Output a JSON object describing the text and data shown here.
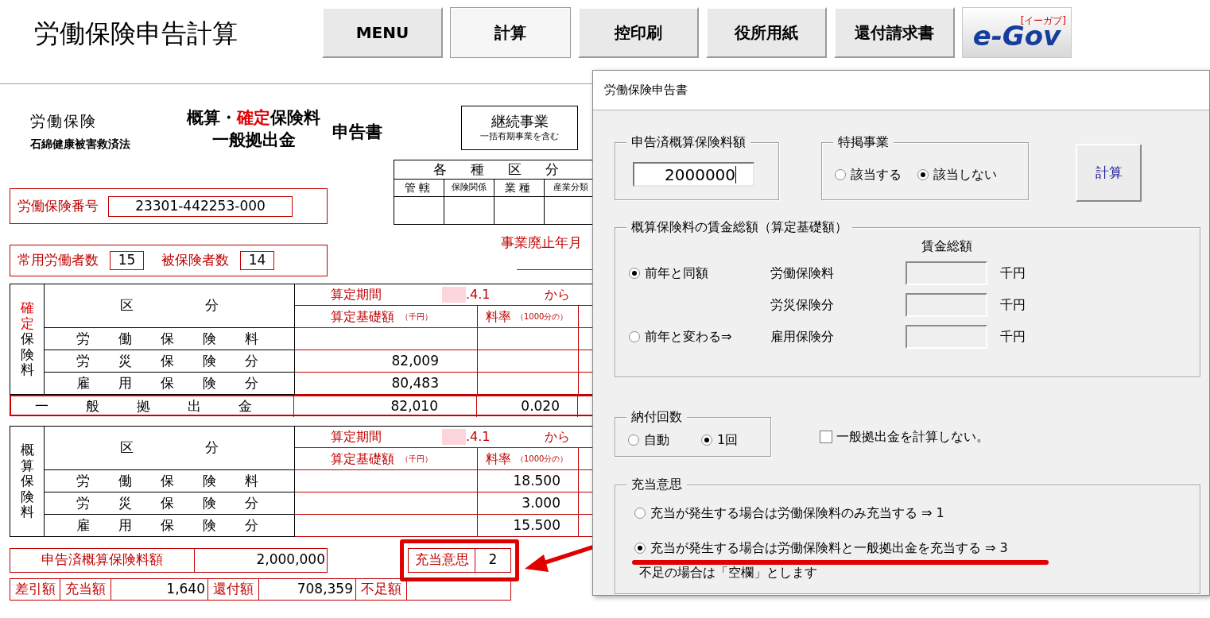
{
  "app_title": "労働保険申告計算",
  "toolbar": [
    {
      "label": "MENU",
      "selected": false
    },
    {
      "label": "計算",
      "selected": true
    },
    {
      "label": "控印刷",
      "selected": false
    },
    {
      "label": "役所用紙",
      "selected": false
    },
    {
      "label": "還付請求書",
      "selected": false
    }
  ],
  "logo": {
    "text": "e-Gov",
    "reading": "[イーガブ]"
  },
  "form": {
    "law_name": "労働保険",
    "law_sub": "石綿健康被害救済法",
    "title_parts": [
      {
        "text": "概算・",
        "highlight": false
      },
      {
        "text": "確定",
        "highlight": true
      },
      {
        "text": "保険料",
        "highlight": false
      }
    ],
    "title_line2": "一般拠出金",
    "title_suffix": "申告書",
    "business_type": {
      "title": "継続事業",
      "note": "一括有期事業を含む"
    },
    "category_table": {
      "title": "各種区分",
      "columns": [
        "管轄",
        "保険関係",
        "業種",
        "産業分類"
      ]
    },
    "insurance_number": {
      "label": "労働保険番号",
      "value": "23301-442253-000"
    },
    "workers": [
      {
        "label": "常用労働者数",
        "value": "15"
      },
      {
        "label": "被保険者数",
        "value": "14"
      }
    ],
    "closure_label": "事業廃止年月",
    "confirmed_table": {
      "side_label": [
        {
          "text": "確定",
          "highlight": true
        },
        {
          "text": "保険料",
          "highlight": false
        }
      ],
      "header": "区分",
      "period_label": "算定期間",
      "period_date": ".4.1",
      "period_from": "から",
      "base_header": "算定基礎額",
      "base_unit": "（千円）",
      "rate_header": "料率",
      "rate_unit": "（1000分の）",
      "rows": [
        {
          "label": "労働保険料"
        },
        {
          "label": "労災保険分",
          "base": "82,009"
        },
        {
          "label": "雇用保険分",
          "base": "80,483"
        }
      ]
    },
    "general_contribution": {
      "label": "一般拠出金",
      "base": "82,010",
      "rate": "0.020"
    },
    "estimated_table": {
      "side_label": [
        {
          "text": "概算保険料",
          "highlight": false
        }
      ],
      "header": "区分",
      "period_label": "算定期間",
      "period_date": ".4.1",
      "period_from": "から",
      "base_header": "算定基礎額",
      "base_unit": "（千円）",
      "rate_header": "料率",
      "rate_unit": "（1000分の）",
      "rows": [
        {
          "label": "労働保険料",
          "rate": "18.500"
        },
        {
          "label": "労災保険分",
          "rate": "3.000"
        },
        {
          "label": "雇用保険分",
          "rate": "15.500"
        }
      ]
    },
    "declared": {
      "label": "申告済概算保険料額",
      "value": "2,000,000"
    },
    "allocation": {
      "label": "充当意思",
      "value": "2",
      "highlighted": true
    },
    "balance_title": "差引額",
    "balance_items": [
      {
        "label": "充当額",
        "value": "1,640"
      },
      {
        "label": "還付額",
        "value": "708,359"
      },
      {
        "label": "不足額"
      }
    ]
  },
  "dialog": {
    "title": "労働保険申告書",
    "declared_group": {
      "legend": "申告済概算保険料額",
      "value": "2000000"
    },
    "special_group": {
      "legend": "特掲事業",
      "options": [
        {
          "label": "該当する",
          "selected": false
        },
        {
          "label": "該当しない",
          "selected": true
        }
      ]
    },
    "calc_button": "計算",
    "wage_group": {
      "legend": "概算保険料の賃金総額（算定基礎額）",
      "column_header": "賃金総額",
      "options": [
        {
          "label": "前年と同額",
          "selected": true
        },
        {
          "label": "前年と変わる⇒",
          "selected": false
        }
      ],
      "fields": [
        {
          "label": "労働保険料",
          "unit": "千円",
          "disabled": true
        },
        {
          "label": "労災保険分",
          "unit": "千円",
          "disabled": true
        },
        {
          "label": "雇用保険分",
          "unit": "千円",
          "disabled": true
        }
      ]
    },
    "payment_group": {
      "legend": "納付回数",
      "options": [
        {
          "label": "自動",
          "selected": false
        },
        {
          "label": "1回",
          "selected": true
        }
      ]
    },
    "no_contribution": {
      "label": "一般拠出金を計算しない。",
      "checked": false
    },
    "allocation_group": {
      "legend": "充当意思",
      "options": [
        {
          "label": "充当が発生する場合は労働保険料のみ充当する ⇒ 1",
          "selected": false,
          "annotated": false
        },
        {
          "label": "充当が発生する場合は労働保険料と一般拠出金を充当する ⇒ 3",
          "selected": true,
          "annotated": true
        }
      ],
      "note": "不足の場合は「空欄」とします"
    }
  }
}
